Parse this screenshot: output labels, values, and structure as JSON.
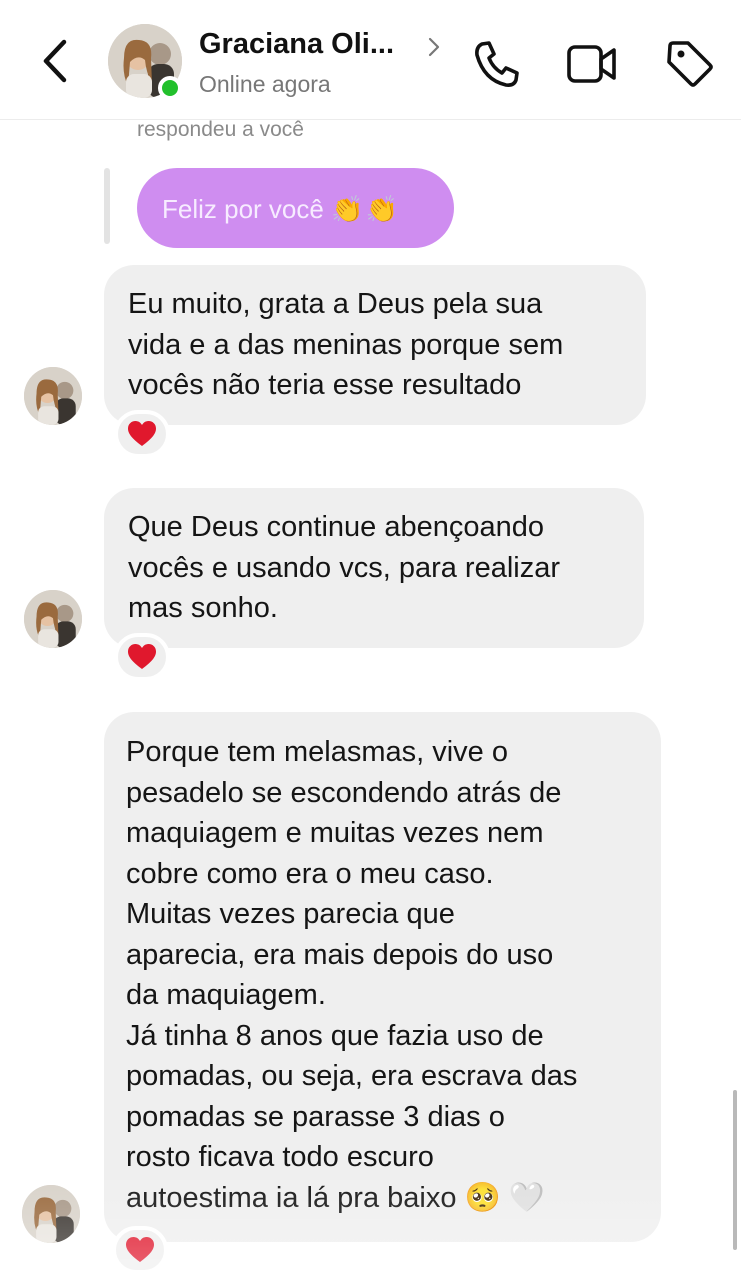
{
  "header": {
    "contact_name": "Graciana Oli...",
    "status": "Online agora",
    "icons": [
      "back-chevron-icon",
      "phone-icon",
      "video-camera-icon",
      "tag-icon"
    ]
  },
  "conversation": {
    "reply_label": "respondeu a você",
    "quoted_message": {
      "text": "Feliz por você",
      "emoji": "👏👏"
    },
    "messages": [
      {
        "lines": [
          "Eu muito, grata a Deus pela sua",
          "vida e a das meninas porque sem",
          "vocês não teria esse resultado"
        ],
        "reaction": "❤"
      },
      {
        "lines": [
          "Que Deus continue abençoando",
          "vocês e usando vcs, para realizar",
          "mas sonho."
        ],
        "reaction": "❤"
      },
      {
        "lines": [
          "Porque tem  melasmas, vive o",
          "pesadelo se escondendo atrás de",
          "maquiagem e muitas vezes nem",
          "cobre como era o meu caso.",
          "Muitas vezes parecia que",
          "aparecia, era mais depois do uso",
          "da maquiagem.",
          "Já tinha 8 anos que fazia uso de",
          "pomadas, ou seja, era escrava das",
          "pomadas se parasse 3 dias o",
          "rosto ficava todo escuro",
          "autoestima ia lá pra baixo"
        ],
        "trailing_emoji": [
          "🥺",
          "🤍"
        ],
        "reaction": "❤"
      }
    ]
  },
  "colors": {
    "quoted_bubble": "#cf8df0",
    "received_bubble": "#efefef",
    "online_dot": "#22c02c",
    "reaction_heart": "#e0182d"
  }
}
